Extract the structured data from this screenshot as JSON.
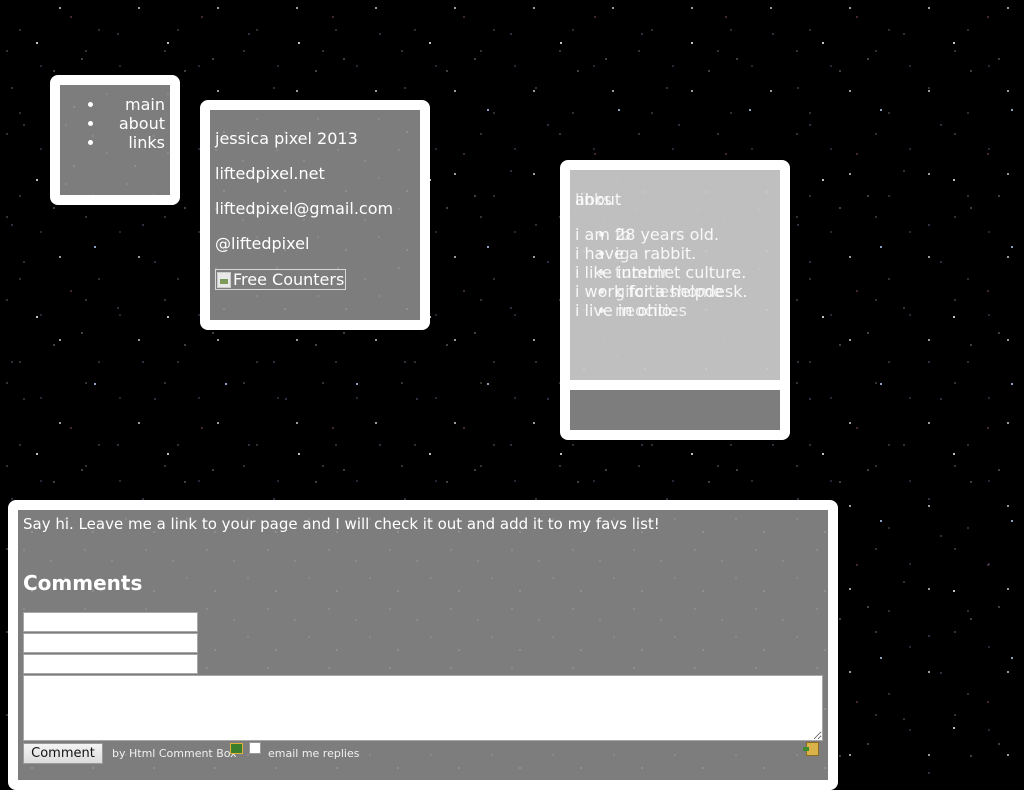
{
  "nav": {
    "items": [
      {
        "label": "main"
      },
      {
        "label": "about"
      },
      {
        "label": "links"
      }
    ]
  },
  "contact": {
    "copyright": "jessica pixel 2013",
    "website": "liftedpixel.net",
    "email": "liftedpixel@gmail.com",
    "twitter": "@liftedpixel",
    "counter_alt": "Free Counters"
  },
  "about": {
    "layer_about": {
      "heading": "about",
      "lines": [
        "i am 28 years old.",
        "i have a rabbit.",
        "i like internet culture.",
        "i work for a helpdesk.",
        "i live in ohio."
      ]
    },
    "layer_links": {
      "heading": "links",
      "items": [
        "fb",
        "ig",
        "tumblr",
        "gifcitieshome",
        "neocities"
      ]
    }
  },
  "comments": {
    "intro": "Say hi. Leave me a link to your page and I will check it out and add it to my favs list!",
    "heading": "Comments",
    "submit_label": "Comment",
    "by_prefix": "by ",
    "by_link": "Html Comment Box",
    "email_replies_label": "email me replies"
  },
  "icons": {
    "bullet": "bullet-icon",
    "broken_image": "broken-image-icon",
    "htmlcommentbox": "htmlcommentbox-icon",
    "login": "login-icon"
  }
}
